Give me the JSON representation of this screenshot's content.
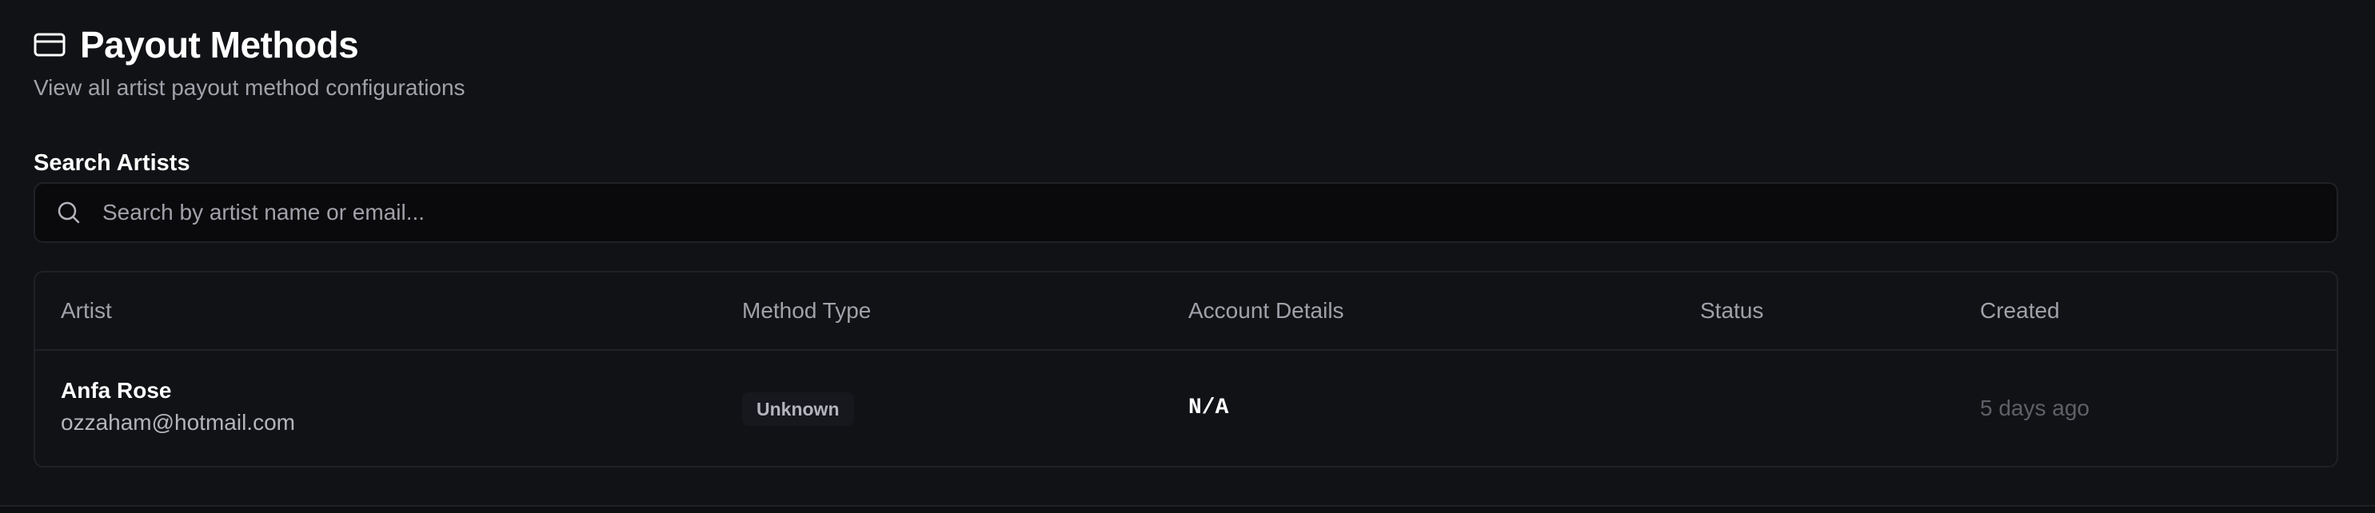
{
  "header": {
    "title": "Payout Methods",
    "subtitle": "View all artist payout method configurations",
    "icon": "credit-card-icon"
  },
  "search": {
    "label": "Search Artists",
    "placeholder": "Search by artist name or email...",
    "value": "",
    "icon": "search-icon"
  },
  "table": {
    "columns": {
      "artist": "Artist",
      "method_type": "Method Type",
      "account_details": "Account Details",
      "status": "Status",
      "created": "Created"
    },
    "rows": [
      {
        "artist_name": "Anfa Rose",
        "artist_email": "ozzaham@hotmail.com",
        "method_type": "Unknown",
        "account_details": "N/A",
        "status": "",
        "created": "5 days ago"
      }
    ]
  },
  "colors": {
    "background": "#111215",
    "border": "#202126",
    "text_primary": "#ffffff",
    "text_muted": "#a1a1aa",
    "text_dim": "#5f6068",
    "badge_bg": "#16181d"
  }
}
